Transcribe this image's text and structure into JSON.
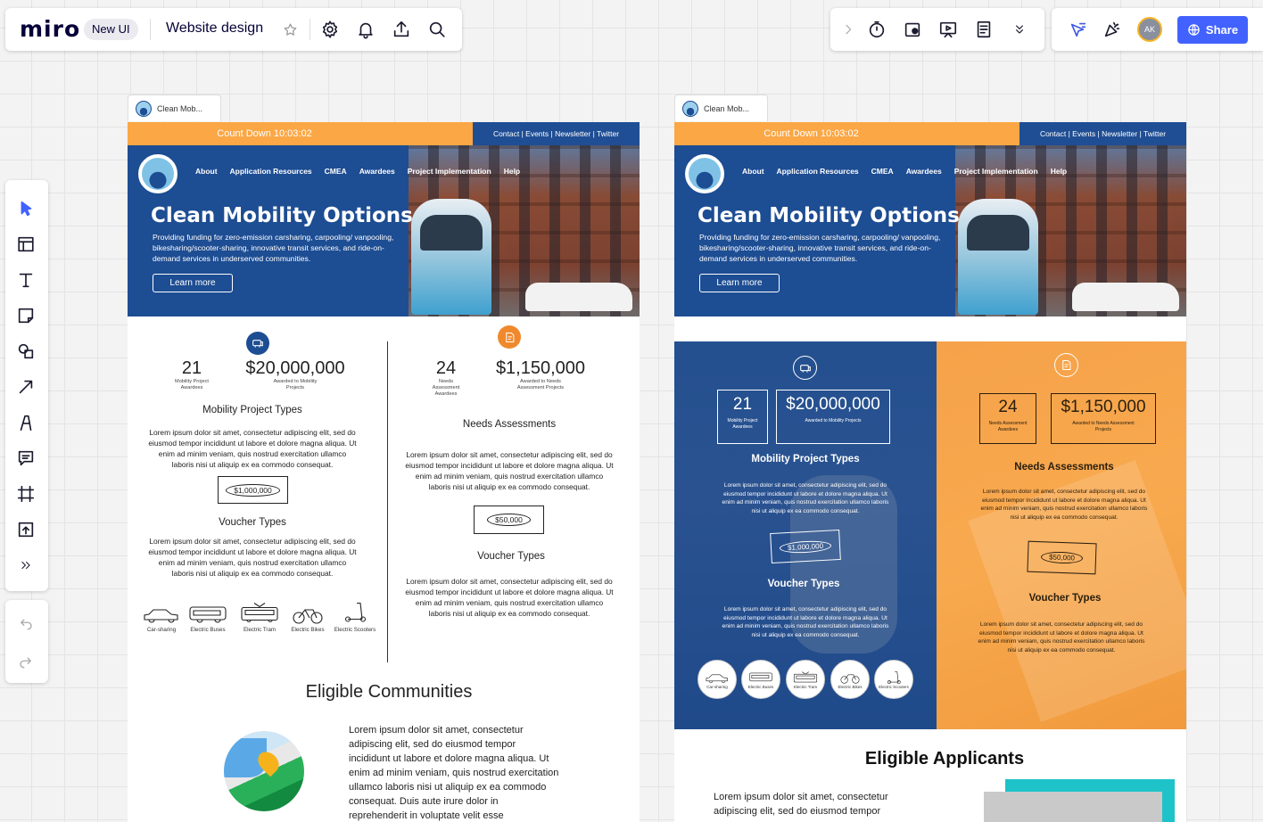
{
  "app": {
    "logo": "miro",
    "badge": "New UI",
    "board_title": "Website design",
    "share_label": "Share",
    "avatar_initials": "AK",
    "accent": "#4262ff"
  },
  "toolbar_icons": [
    "star-icon",
    "gear-icon",
    "bell-icon",
    "upload-icon",
    "search-icon"
  ],
  "right_tools": [
    "chevron-right-icon",
    "timer-icon",
    "board-settings-icon",
    "present-icon",
    "notes-icon",
    "double-chevron-down-icon",
    "reactions-cursor-icon",
    "celebrate-icon"
  ],
  "left_tools": [
    "select-icon",
    "table-icon",
    "text-icon",
    "sticky-note-icon",
    "shapes-icon",
    "arrow-icon",
    "pen-icon",
    "comment-icon",
    "frame-icon",
    "upload-icon",
    "more-icon",
    "undo-icon",
    "redo-icon"
  ],
  "frames": [
    {
      "tab": "Clean Mob...",
      "countdown": "Count Down 10:03:02",
      "toplinks": "Contact | Events | Newsletter | Twitter",
      "nav": [
        "About",
        "Application Resources",
        "CMEA",
        "Awardees",
        "Project Implementation",
        "Help"
      ],
      "hero_title": "Clean Mobility Options",
      "hero_text": "Providing funding for zero-emission carsharing, carpooling/ vanpooling, bikesharing/scooter-sharing, innovative transit services, and ride-on-demand services in underserved communities.",
      "hero_button": "Learn more",
      "left": {
        "stat1_num": "21",
        "stat1_cap": "Mobility Project Awardees",
        "stat2_num": "$20,000,000",
        "stat2_cap": "Awarded to Mobility Projects",
        "title": "Mobility Project Types",
        "text": "Lorem ipsum dolor sit amet, consectetur adipiscing elit, sed do eiusmod tempor incididunt ut labore et dolore magna aliqua. Ut enim ad minim veniam, quis nostrud exercitation ullamco laboris nisi ut aliquip ex ea commodo consequat.",
        "money": "$1,000,000",
        "title2": "Voucher Types",
        "text2": "Lorem ipsum dolor sit amet, consectetur adipiscing elit, sed do eiusmod tempor incididunt ut labore et dolore magna aliqua. Ut enim ad minim veniam, quis nostrud exercitation ullamco laboris nisi ut aliquip ex ea commodo consequat.",
        "vehicles": [
          "Car-sharing",
          "Electric Buses",
          "Electric Tram",
          "Electric Bikes",
          "Electric Scooters"
        ]
      },
      "right": {
        "stat1_num": "24",
        "stat1_cap": "Needs Assessment Awardees",
        "stat2_num": "$1,150,000",
        "stat2_cap": "Awarded to Needs Assessment Projects",
        "title": "Needs Assessments",
        "text": "Lorem ipsum dolor sit amet, consectetur adipiscing elit, sed do eiusmod tempor incididunt ut labore et dolore magna aliqua. Ut enim ad minim veniam, quis nostrud exercitation ullamco laboris nisi ut aliquip ex ea commodo consequat.",
        "money": "$50,000",
        "title2": "Voucher Types",
        "text2": "Lorem ipsum dolor sit amet, consectetur adipiscing elit, sed do eiusmod tempor incididunt ut labore et dolore magna aliqua. Ut enim ad minim veniam, quis nostrud exercitation ullamco laboris nisi ut aliquip ex ea commodo consequat."
      },
      "section_title": "Eligible Communities",
      "section_text": "Lorem ipsum dolor sit amet, consectetur adipiscing elit, sed do eiusmod tempor incididunt ut labore et dolore magna aliqua. Ut enim ad minim veniam, quis nostrud exercitation ullamco laboris nisi ut aliquip ex ea commodo consequat. Duis aute irure dolor in reprehenderit in voluptate velit esse"
    },
    {
      "tab": "Clean Mob...",
      "countdown": "Count Down 10:03:02",
      "toplinks": "Contact | Events | Newsletter | Twitter",
      "nav": [
        "About",
        "Application Resources",
        "CMEA",
        "Awardees",
        "Project Implementation",
        "Help"
      ],
      "hero_title": "Clean Mobility Options",
      "hero_text": "Providing funding for zero-emission carsharing, carpooling/ vanpooling, bikesharing/scooter-sharing, innovative transit services, and ride-on-demand services in underserved communities.",
      "hero_button": "Learn more",
      "left": {
        "stat1_num": "21",
        "stat1_cap": "Mobility Project Awardees",
        "stat2_num": "$20,000,000",
        "stat2_cap": "Awarded to Mobility Projects",
        "title": "Mobility Project Types",
        "text": "Lorem ipsum dolor sit amet, consectetur adipiscing elit, sed do eiusmod tempor incididunt ut labore et dolore magna aliqua. Ut enim ad minim veniam, quis nostrud exercitation ullamco laboris nisi ut aliquip ex ea commodo consequat.",
        "money": "$1,000,000",
        "title2": "Voucher Types",
        "text2": "Lorem ipsum dolor sit amet, consectetur adipiscing elit, sed do eiusmod tempor incididunt ut labore et dolore magna aliqua. Ut enim ad minim veniam, quis nostrud exercitation ullamco laboris nisi ut aliquip ex ea commodo consequat.",
        "vehicles": [
          "Car-sharing",
          "Electric Buses",
          "Electric Tram",
          "Electric Bikes",
          "Electric Scooters"
        ]
      },
      "right": {
        "stat1_num": "24",
        "stat1_cap": "Needs Assessment Awardees",
        "stat2_num": "$1,150,000",
        "stat2_cap": "Awarded to Needs Assessment Projects",
        "title": "Needs Assessments",
        "text": "Lorem ipsum dolor sit amet, consectetur adipiscing elit, sed do eiusmod tempor incididunt ut labore et dolore magna aliqua. Ut enim ad minim veniam, quis nostrud exercitation ullamco laboris nisi ut aliquip ex ea commodo consequat.",
        "money": "$50,000",
        "title2": "Voucher Types",
        "text2": "Lorem ipsum dolor sit amet, consectetur adipiscing elit, sed do eiusmod tempor incididunt ut labore et dolore magna aliqua. Ut enim ad minim veniam, quis nostrud exercitation ullamco laboris nisi ut aliquip ex ea commodo consequat."
      },
      "section_title": "Eligible Applicants",
      "section_text": "Lorem ipsum dolor sit amet, consectetur adipiscing elit, sed do eiusmod tempor"
    }
  ],
  "colors": {
    "navy": "#1d4d92",
    "orange": "#fba745"
  }
}
